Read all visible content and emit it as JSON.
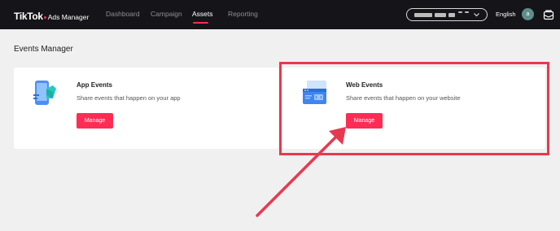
{
  "header": {
    "logo_main": "TikTok",
    "logo_sub": "Ads Manager",
    "nav": [
      {
        "label": "Dashboard"
      },
      {
        "label": "Campaign"
      },
      {
        "label": "Assets"
      },
      {
        "label": "Reporting"
      }
    ],
    "language": "English",
    "avatar_initial": "a"
  },
  "page": {
    "title": "Events Manager"
  },
  "cards": {
    "app": {
      "title": "App Events",
      "description": "Share events that happen on your app",
      "button": "Manage"
    },
    "web": {
      "title": "Web Events",
      "description": "Share events that happen on your website",
      "button": "Manage"
    }
  },
  "colors": {
    "accent": "#fe2c55",
    "topbar": "#151519",
    "annotation": "#e8384f"
  }
}
